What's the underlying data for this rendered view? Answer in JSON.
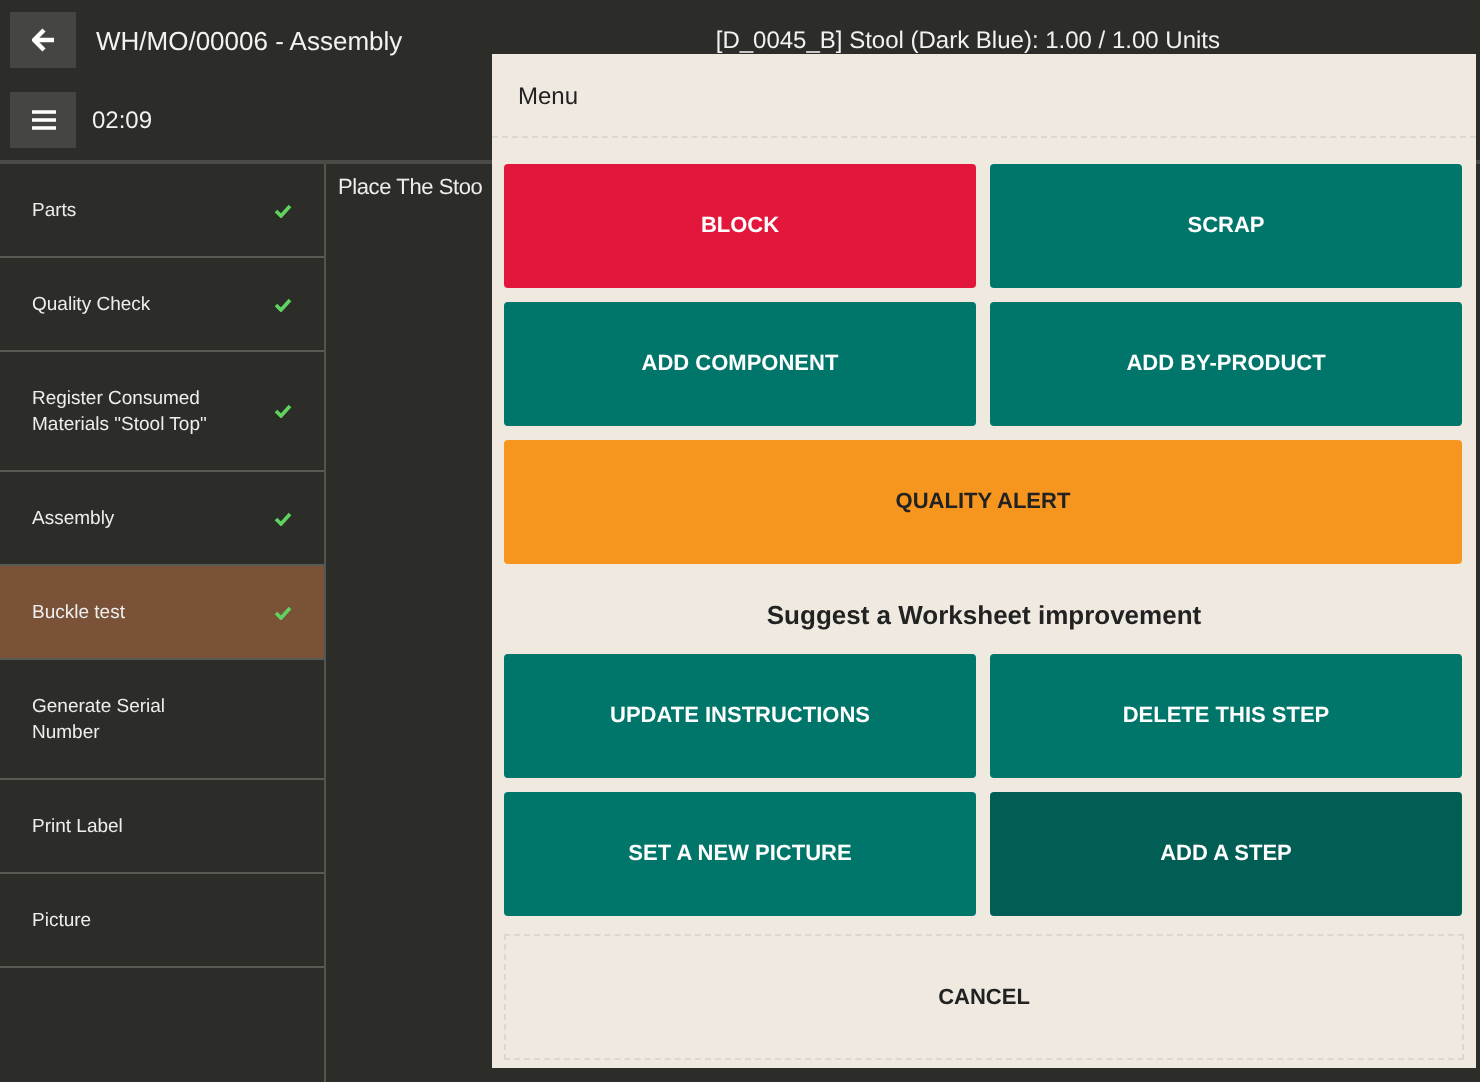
{
  "header": {
    "title": "WH/MO/00006 - Assembly",
    "product": "[D_0045_B] Stool (Dark Blue): 1.00 / 1.00 Units",
    "timer": "02:09"
  },
  "steps": [
    {
      "label": "Parts",
      "done": true,
      "selected": false
    },
    {
      "label": "Quality Check",
      "done": true,
      "selected": false
    },
    {
      "label": "Register Consumed Materials \"Stool Top\"",
      "done": true,
      "selected": false
    },
    {
      "label": "Assembly",
      "done": true,
      "selected": false
    },
    {
      "label": "Buckle test",
      "done": true,
      "selected": true
    },
    {
      "label": "Generate Serial Number",
      "done": false,
      "selected": false
    },
    {
      "label": "Print Label",
      "done": false,
      "selected": false
    },
    {
      "label": "Picture",
      "done": false,
      "selected": false
    }
  ],
  "instruction": "Place The Stoo",
  "menu": {
    "title": "Menu",
    "actions": [
      {
        "label": "BLOCK",
        "kind": "danger",
        "wide": false,
        "hovered": false
      },
      {
        "label": "SCRAP",
        "kind": "primary",
        "wide": false,
        "hovered": false
      },
      {
        "label": "ADD COMPONENT",
        "kind": "primary",
        "wide": false,
        "hovered": false
      },
      {
        "label": "ADD BY-PRODUCT",
        "kind": "primary",
        "wide": false,
        "hovered": false
      },
      {
        "label": "QUALITY ALERT",
        "kind": "warning",
        "wide": true,
        "hovered": false
      }
    ],
    "improvement_heading": "Suggest a Worksheet improvement",
    "improvements": [
      {
        "label": "UPDATE INSTRUCTIONS",
        "kind": "primary",
        "wide": false,
        "hovered": false
      },
      {
        "label": "DELETE THIS STEP",
        "kind": "primary",
        "wide": false,
        "hovered": false
      },
      {
        "label": "SET A NEW PICTURE",
        "kind": "primary",
        "wide": false,
        "hovered": false
      },
      {
        "label": "ADD A STEP",
        "kind": "primary",
        "wide": false,
        "hovered": true
      }
    ],
    "cancel": "CANCEL"
  }
}
